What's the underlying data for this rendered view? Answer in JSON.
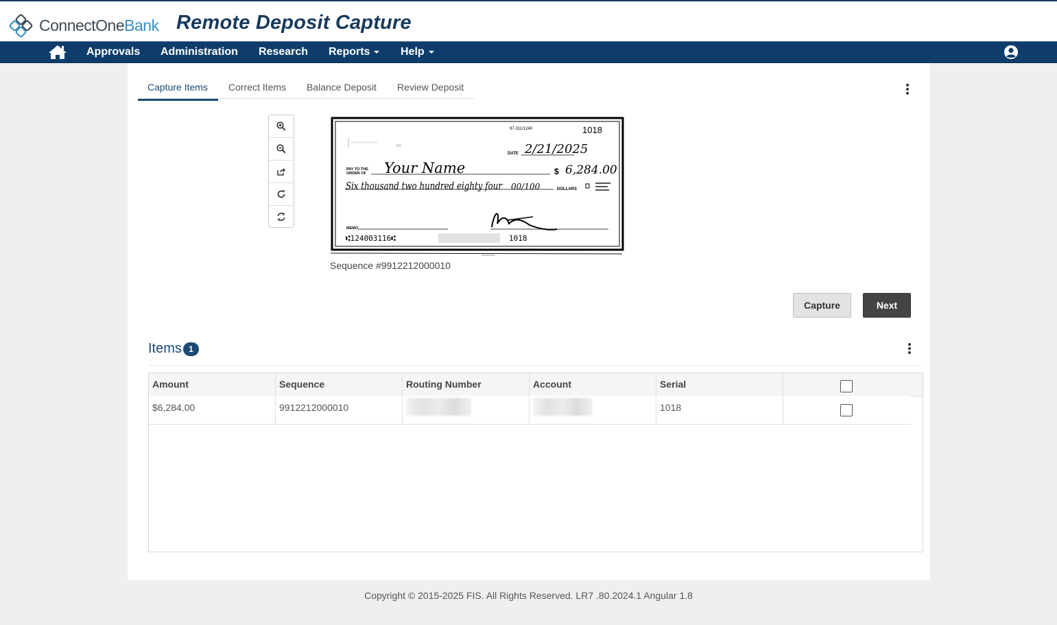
{
  "app": {
    "brand_connect": "ConnectOne",
    "brand_bank": "Bank",
    "title": "Remote Deposit Capture"
  },
  "nav": {
    "items": [
      {
        "label": "Approvals"
      },
      {
        "label": "Administration"
      },
      {
        "label": "Research"
      },
      {
        "label": "Reports"
      },
      {
        "label": "Help"
      }
    ]
  },
  "tabs": [
    {
      "label": "Capture Items",
      "active": true
    },
    {
      "label": "Correct Items"
    },
    {
      "label": "Balance Deposit"
    },
    {
      "label": "Review Deposit"
    }
  ],
  "check": {
    "routing_code": "97-311/1240",
    "number": "1018",
    "date_label": "DATE",
    "date": "2/21/2025",
    "pay_to_label": "PAY TO THE ORDER OF",
    "payee": "Your Name",
    "amount": "6,284.00",
    "written_amount": "Six thousand two hundred eighty four",
    "written_cents": "00/100",
    "dollars_label": "DOLLARS",
    "memo_label": "MEMO",
    "micr_routing": "⑆124003116⑆",
    "micr_serial": "1018",
    "caption": "Sequence #9912212000010"
  },
  "buttons": {
    "capture": "Capture",
    "next": "Next"
  },
  "items": {
    "title": "Items",
    "count": "1",
    "columns": [
      "Amount",
      "Sequence",
      "Routing Number",
      "Account",
      "Serial"
    ],
    "rows": [
      {
        "amount": "$6,284.00",
        "sequence": "9912212000010",
        "routing": "",
        "account": "",
        "serial": "1018",
        "checked": false
      }
    ]
  },
  "footer": {
    "copyright": "Copyright © 2015-2025 FIS. All Rights Reserved. LR7 .80.2024.1 Angular 1.8"
  },
  "colors": {
    "navy": "#0e3d6b",
    "title_blue": "#17395c",
    "brand_light_blue": "#3a8fc4"
  },
  "icons": [
    "connectone-logo-icon",
    "home-icon",
    "user-icon",
    "zoom-in-icon",
    "zoom-out-icon",
    "share-icon",
    "rotate-icon",
    "refresh-icon",
    "more-vertical-icon"
  ]
}
